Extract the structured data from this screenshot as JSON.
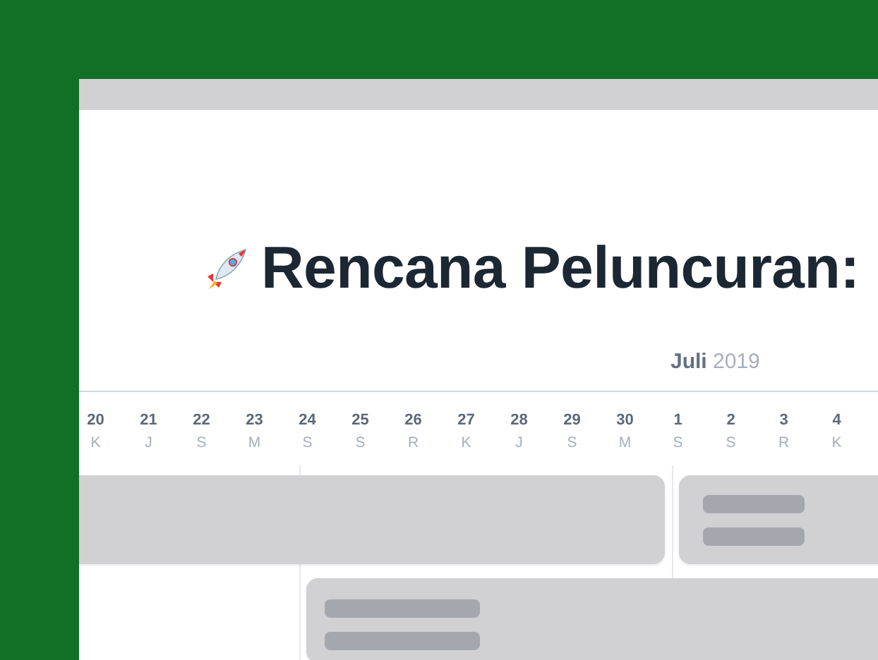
{
  "title": "Rencana Peluncuran:",
  "month": {
    "name": "Juli",
    "year": "2019"
  },
  "days": [
    {
      "date": "20",
      "weekday": "K"
    },
    {
      "date": "21",
      "weekday": "J"
    },
    {
      "date": "22",
      "weekday": "S"
    },
    {
      "date": "23",
      "weekday": "M"
    },
    {
      "date": "24",
      "weekday": "S"
    },
    {
      "date": "25",
      "weekday": "S"
    },
    {
      "date": "26",
      "weekday": "R"
    },
    {
      "date": "27",
      "weekday": "K"
    },
    {
      "date": "28",
      "weekday": "J"
    },
    {
      "date": "29",
      "weekday": "S"
    },
    {
      "date": "30",
      "weekday": "M"
    },
    {
      "date": "1",
      "weekday": "S"
    },
    {
      "date": "2",
      "weekday": "S"
    },
    {
      "date": "3",
      "weekday": "R"
    },
    {
      "date": "4",
      "weekday": "K"
    }
  ]
}
